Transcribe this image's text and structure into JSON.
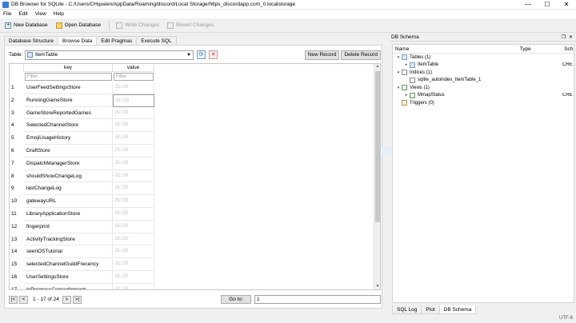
{
  "window": {
    "title": "DB Browser for SQLite - C:/Users/CHqueen/AppData/Roaming/discord/Local Storage/https_discordapp.com_0.localstorage",
    "controls": [
      "—",
      "☐",
      "✕"
    ]
  },
  "menu": [
    "File",
    "Edit",
    "View",
    "Help"
  ],
  "toolbar": {
    "new_database": "New Database",
    "open_database": "Open Database",
    "write_changes": "Write Changes",
    "revert_changes": "Revert Changes"
  },
  "tabs": [
    "Database Structure",
    "Browse Data",
    "Edit Pragmas",
    "Execute SQL"
  ],
  "active_tab": "Browse Data",
  "browse": {
    "table_label": "Table:",
    "table_value": "ItemTable",
    "new_record": "New Record",
    "delete_record": "Delete Record",
    "columns": [
      "key",
      "value"
    ],
    "filter_placeholder": "Filter",
    "blob_label": "BLOB",
    "rows": [
      {
        "n": "1",
        "key": "UserFeedSettingsStore"
      },
      {
        "n": "2",
        "key": "RunningGameStore"
      },
      {
        "n": "3",
        "key": "GameStoreReportedGames"
      },
      {
        "n": "4",
        "key": "SelectedChannelStore"
      },
      {
        "n": "5",
        "key": "EmojiUsageHistory"
      },
      {
        "n": "6",
        "key": "DraftStore"
      },
      {
        "n": "7",
        "key": "DispatchManagerStore"
      },
      {
        "n": "8",
        "key": "shouldShowChangeLog"
      },
      {
        "n": "9",
        "key": "lastChangeLog"
      },
      {
        "n": "10",
        "key": "gatewayURL"
      },
      {
        "n": "11",
        "key": "LibraryApplicationStore"
      },
      {
        "n": "12",
        "key": "fingerprint"
      },
      {
        "n": "13",
        "key": "ActivityTrackingStore"
      },
      {
        "n": "14",
        "key": "seenOSTutorial"
      },
      {
        "n": "15",
        "key": "selectedChannelGuildFrecency"
      },
      {
        "n": "16",
        "key": "UserSettingsStore"
      },
      {
        "n": "17",
        "key": "InProgressContactImports"
      }
    ],
    "nav": {
      "first": "|<",
      "prev": "<",
      "range": "1 - 17 of 24",
      "next": ">",
      "last": ">|",
      "goto_label": "Go to:",
      "goto_value": "1"
    }
  },
  "schema": {
    "title": "DB Schema",
    "columns": [
      "Name",
      "Type",
      "Sch"
    ],
    "tree": [
      {
        "level": 0,
        "exp": "▾",
        "icon": "table",
        "label": "Tables (1)",
        "right": ""
      },
      {
        "level": 1,
        "exp": "▸",
        "icon": "table",
        "label": "ItemTable",
        "right": "CRE"
      },
      {
        "level": 0,
        "exp": "▾",
        "icon": "index",
        "label": "Indices (1)",
        "right": ""
      },
      {
        "level": 1,
        "exp": "",
        "icon": "index",
        "label": "sqlite_autoindex_ItemTable_1",
        "right": ""
      },
      {
        "level": 0,
        "exp": "▾",
        "icon": "view",
        "label": "Views (1)",
        "right": ""
      },
      {
        "level": 1,
        "exp": "▸",
        "icon": "view",
        "label": "MmapStatus",
        "right": "CRE"
      },
      {
        "level": 0,
        "exp": "",
        "icon": "trigger",
        "label": "Triggers (0)",
        "right": ""
      }
    ],
    "bottom_tabs": [
      "SQL Log",
      "Plot",
      "DB Schema"
    ],
    "active_bottom_tab": "DB Schema"
  },
  "status": {
    "encoding": "UTF-8"
  }
}
